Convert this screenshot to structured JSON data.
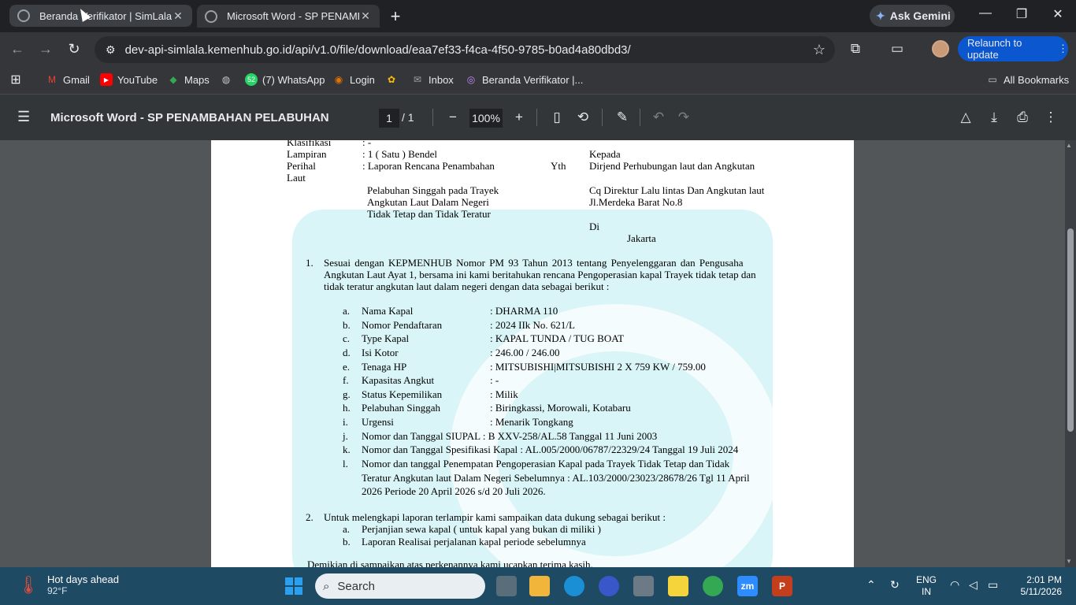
{
  "browser": {
    "tabs": [
      {
        "title": "Beranda Verifikator | SimLala",
        "active": false
      },
      {
        "title": "Microsoft Word - SP PENAMBAHAN PELABUHAN",
        "active": true
      }
    ],
    "ask_gemini": "Ask Gemini",
    "url": "dev-api-simlala.kemenhub.go.id/api/v1.0/file/download/eaa7ef33-f4ca-4f50-9785-b0ad4a80dbd3/",
    "relaunch": "Relaunch to update",
    "bookmarks": [
      {
        "label": "Gmail",
        "icon": "gmail-icon"
      },
      {
        "label": "YouTube",
        "icon": "youtube-icon"
      },
      {
        "label": "Maps",
        "icon": "maps-icon"
      },
      {
        "label": "(7) WhatsApp",
        "icon": "whatsapp-icon",
        "badge": "52"
      },
      {
        "label": "Login",
        "icon": "login-icon"
      },
      {
        "label": "Inbox",
        "icon": "inbox-icon"
      },
      {
        "label": "Beranda Verifikator |...",
        "icon": "simlala-icon"
      }
    ],
    "all_bookmarks": "All Bookmarks"
  },
  "pdf": {
    "title": "Microsoft Word - SP PENAMBAHAN PELABUHAN",
    "page_current": "1",
    "page_total": "/ 1",
    "zoom": "100%"
  },
  "document": {
    "header": {
      "klasifikasi_label": "Klasifikasi",
      "klasifikasi_value": ": -",
      "lampiran_label": "Lampiran",
      "lampiran_value": ": 1 ( Satu ) Bendel",
      "perihal_label": "Perihal",
      "perihal_value": ": Laporan Rencana Penambahan",
      "laut": "Laut",
      "perihal_cont1": "Pelabuhan Singgah pada Trayek",
      "perihal_cont2": "Angkutan Laut Dalam Negeri",
      "perihal_cont3": "Tidak Tetap dan Tidak Teratur",
      "yth": "Yth",
      "kepada": "Kepada",
      "recipient1": "Dirjend Perhubungan laut dan Angkutan",
      "recipient2": "Cq  Direktur Lalu lintas Dan Angkutan laut",
      "recipient3": "Jl.Merdeka Barat No.8",
      "di": "Di",
      "city": "Jakarta"
    },
    "para1_num": "1.",
    "para1_lines": [
      "Sesuai  dengan  KEPMENHUB  Nomor  PM  93  Tahun  2013  tentang  Penyelenggaran  dan  Pengusaha",
      "Angkutan Laut Ayat 1, bersama ini kami beritahukan rencana Pengoperasian kapal Trayek tidak tetap dan",
      "tidak teratur angkutan laut dalam negeri dengan data sebagai berikut :"
    ],
    "items": [
      {
        "letter": "a.",
        "label": "Nama Kapal",
        "value": ": DHARMA 110"
      },
      {
        "letter": "b.",
        "label": "Nomor Pendaftaran",
        "value": ": 2024 IIk No. 621/L"
      },
      {
        "letter": "c.",
        "label": "Type Kapal",
        "value": ": KAPAL TUNDA / TUG BOAT"
      },
      {
        "letter": "d.",
        "label": "Isi Kotor",
        "value": ": 246.00 / 246.00"
      },
      {
        "letter": "e.",
        "label": "Tenaga HP",
        "value": ": MITSUBISHI|MITSUBISHI 2 X 759 KW / 759.00"
      },
      {
        "letter": "f.",
        "label": "Kapasitas Angkut",
        "value": ": -"
      },
      {
        "letter": "g.",
        "label": "Status Kepemilikan",
        "value": ": Milik"
      },
      {
        "letter": "h.",
        "label": "Pelabuhan Singgah",
        "value": ": Biringkassi, Morowali, Kotabaru"
      },
      {
        "letter": "i.",
        "label": "Urgensi",
        "value": ": Menarik Tongkang"
      }
    ],
    "item_j": {
      "letter": "j.",
      "text": "Nomor dan Tanggal SIUPAL : B XXV-258/AL.58 Tanggal 11 Juni 2003"
    },
    "item_k": {
      "letter": "k.",
      "text": "Nomor dan Tanggal Spesifikasi Kapal : AL.005/2000/06787/22329/24 Tanggal 19 Juli 2024"
    },
    "item_l": {
      "letter": "l.",
      "lines": [
        "Nomor dan tanggal Penempatan Pengoperasian Kapal  pada Trayek Tidak Tetap dan Tidak",
        "Teratur Angkutan laut Dalam Negeri Sebelumnya : AL.103/2000/23023/28678/26 Tgl 11 April",
        "2026 Periode 20 April 2026 s/d 20 Juli 2026."
      ]
    },
    "para2_num": "2.",
    "para2_text": "Untuk melengkapi laporan terlampir kami sampaikan data dukung sebagai berikut :",
    "para2_items": [
      {
        "letter": "a.",
        "text": "Perjanjian sewa kapal ( untuk kapal yang bukan di miliki )"
      },
      {
        "letter": "b.",
        "text": "Laporan Realisai perjalanan  kapal periode sebelumnya"
      }
    ],
    "closing": "Demikian di sampaikan  atas perkenannya kami ucapkan terima kasih."
  },
  "taskbar": {
    "weather_title": "Hot days ahead",
    "weather_temp": "92°F",
    "search": "Search",
    "lang1": "ENG",
    "lang2": "IN",
    "time": "2:01 PM",
    "date": "5/11/2026"
  }
}
